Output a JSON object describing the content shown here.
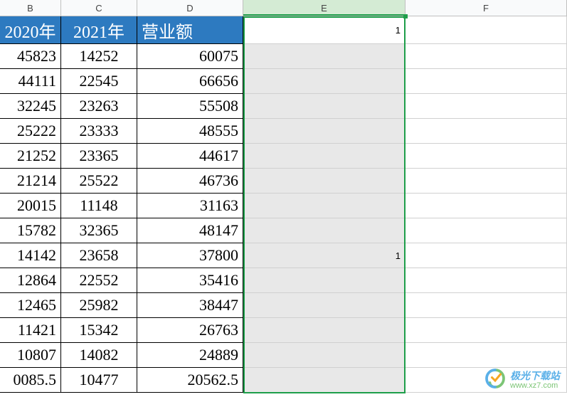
{
  "columns": {
    "B": "B",
    "C": "C",
    "D": "D",
    "E": "E",
    "F": "F"
  },
  "headers": {
    "B": "2020年",
    "C": "2021年",
    "D": "营业额"
  },
  "rows": [
    {
      "B": "45823",
      "C": "14252",
      "D": "60075"
    },
    {
      "B": "44111",
      "C": "22545",
      "D": "66656"
    },
    {
      "B": "32245",
      "C": "23263",
      "D": "55508"
    },
    {
      "B": "25222",
      "C": "23333",
      "D": "48555"
    },
    {
      "B": "21252",
      "C": "23365",
      "D": "44617"
    },
    {
      "B": "21214",
      "C": "25522",
      "D": "46736"
    },
    {
      "B": "20015",
      "C": "11148",
      "D": "31163"
    },
    {
      "B": "15782",
      "C": "32365",
      "D": "48147"
    },
    {
      "B": "14142",
      "C": "23658",
      "D": "37800"
    },
    {
      "B": "12864",
      "C": "22552",
      "D": "35416"
    },
    {
      "B": "12465",
      "C": "25982",
      "D": "38447"
    },
    {
      "B": "11421",
      "C": "15342",
      "D": "26763"
    },
    {
      "B": "10807",
      "C": "14082",
      "D": "24889"
    },
    {
      "B": "0085.5",
      "C": "10477",
      "D": "20562.5"
    }
  ],
  "selection": {
    "col": "E",
    "E1": "1",
    "E9": "1"
  },
  "watermark": {
    "title": "极光下载站",
    "url": "www.xz7.com"
  }
}
